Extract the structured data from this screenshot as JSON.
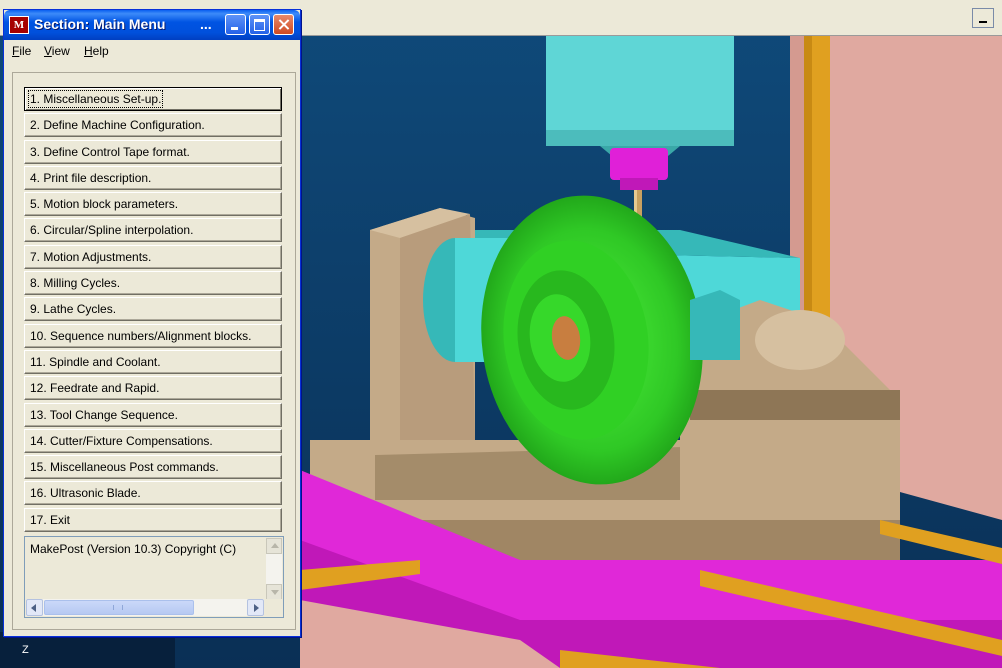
{
  "window": {
    "title": "Section: Main Menu",
    "title_overflow": "...",
    "app_icon_text": "M",
    "title_color": "#0054e3"
  },
  "menubar": {
    "items": [
      {
        "label": "File"
      },
      {
        "label": "View"
      },
      {
        "label": "Help"
      }
    ]
  },
  "main_menu": {
    "selected_index": 0,
    "items": [
      {
        "label": "1.  Miscellaneous Set-up."
      },
      {
        "label": "2.  Define Machine Configuration."
      },
      {
        "label": "3.  Define Control Tape format."
      },
      {
        "label": "4.  Print file description."
      },
      {
        "label": "5.  Motion block parameters."
      },
      {
        "label": "6.  Circular/Spline interpolation."
      },
      {
        "label": "7.  Motion Adjustments."
      },
      {
        "label": "8.  Milling Cycles."
      },
      {
        "label": "9.  Lathe Cycles."
      },
      {
        "label": "10.  Sequence numbers/Alignment blocks."
      },
      {
        "label": "11.  Spindle and Coolant."
      },
      {
        "label": "12.  Feedrate and Rapid."
      },
      {
        "label": "13.  Tool Change Sequence."
      },
      {
        "label": "14.  Cutter/Fixture Compensations."
      },
      {
        "label": "15.  Miscellaneous Post commands."
      },
      {
        "label": "16.  Ultrasonic Blade."
      },
      {
        "label": "17.  Exit"
      }
    ]
  },
  "info": {
    "text": "MakePost    (Version 10.3)  Copyright (C)"
  },
  "viewport": {
    "axis_label": "Z",
    "colors": {
      "background": "#0d3a67",
      "wall": "#e0a9a0",
      "column": "#5fd6d6",
      "spindle": "#e020d8",
      "fixture": "#c4aa88",
      "workpiece": "#3ad82c",
      "table": "#e028d8",
      "rail": "#e0a020"
    }
  }
}
